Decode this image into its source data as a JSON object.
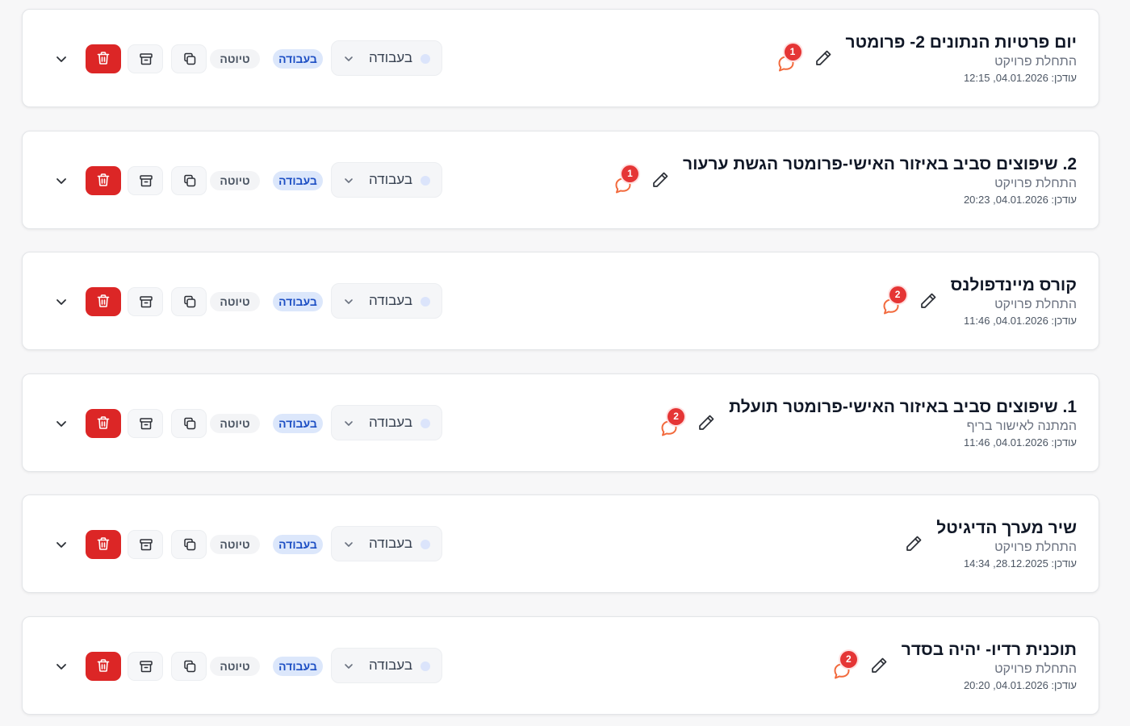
{
  "colors": {
    "page_bg": "#f7f7f8",
    "card_bg": "#ffffff",
    "delete_red": "#dc2626",
    "comment_orange": "#f26a3d",
    "badge_red": "#e53535",
    "work_badge_bg": "#dce7fb",
    "work_badge_text": "#1d4fc4"
  },
  "projects": [
    {
      "title": "יום פרטיות הנתונים 2- פרומטר",
      "subtitle": "התחלת פרויקט",
      "updated": "עודכן: 04.01.2026, 12:15",
      "comments": "1",
      "status": "בעבודה",
      "badge_work": "בעבודה",
      "badge_draft": "טיוטה"
    },
    {
      "title": "2. שיפוצים סביב באיזור האישי-פרומטר הגשת ערעור",
      "subtitle": "התחלת פרויקט",
      "updated": "עודכן: 04.01.2026, 20:23",
      "comments": "1",
      "status": "בעבודה",
      "badge_work": "בעבודה",
      "badge_draft": "טיוטה"
    },
    {
      "title": "קורס מיינדפולנס",
      "subtitle": "התחלת פרויקט",
      "updated": "עודכן: 04.01.2026, 11:46",
      "comments": "2",
      "status": "בעבודה",
      "badge_work": "בעבודה",
      "badge_draft": "טיוטה"
    },
    {
      "title": "1. שיפוצים סביב באיזור האישי-פרומטר תועלת",
      "subtitle": "המתנה לאישור בריף",
      "updated": "עודכן: 04.01.2026, 11:46",
      "comments": "2",
      "status": "בעבודה",
      "badge_work": "בעבודה",
      "badge_draft": "טיוטה"
    },
    {
      "title": "שיר מערך הדיגיטל",
      "subtitle": "התחלת פרויקט",
      "updated": "עודכן: 28.12.2025, 14:34",
      "comments": "",
      "status": "בעבודה",
      "badge_work": "בעבודה",
      "badge_draft": "טיוטה"
    },
    {
      "title": "תוכנית רדיו- יהיה בסדר",
      "subtitle": "התחלת פרויקט",
      "updated": "עודכן: 04.01.2026, 20:20",
      "comments": "2",
      "status": "בעבודה",
      "badge_work": "בעבודה",
      "badge_draft": "טיוטה"
    }
  ]
}
